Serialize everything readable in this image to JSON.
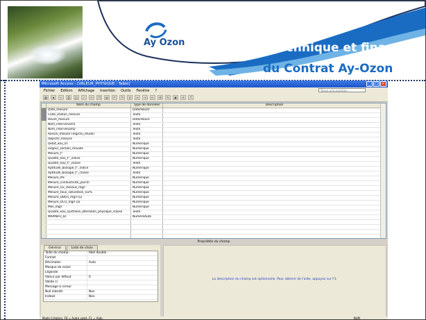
{
  "slide": {
    "logo_text": "Ay Ozon",
    "title_line1": "Suivi technique et financier",
    "title_line2": "du Contrat Ay-Ozon"
  },
  "window": {
    "title": "Microsoft Access - [VALEUR_PHYSIQUE : Table]",
    "menu": [
      "Fichier",
      "Edition",
      "Affichage",
      "Insertion",
      "Outils",
      "Fenêtre",
      "?"
    ],
    "help_placeholder": "Tapez une question"
  },
  "grid": {
    "headers": [
      "Nom du champ",
      "Type de données",
      "Description"
    ],
    "rows": [
      {
        "name": "Date_mesure",
        "type": "Date/Heure"
      },
      {
        "name": "Code_station_mesure",
        "type": "Texte"
      },
      {
        "name": "Heure_mesure",
        "type": "Date/Heure"
      },
      {
        "name": "Nom_intervenant1",
        "type": "Texte"
      },
      {
        "name": "Nom_intervenant2",
        "type": "Texte"
      },
      {
        "name": "Raison_mesure (reg/ctu_etude)",
        "type": "Texte"
      },
      {
        "name": "Objectif_mesure",
        "type": "Texte"
      },
      {
        "name": "Debit_eau_l/s",
        "type": "Numérique"
      },
      {
        "name": "largeur_section_mouille",
        "type": "Numérique"
      },
      {
        "name": "Mesure_t°",
        "type": "Numérique"
      },
      {
        "name": "Qualite_eau_t°_indice",
        "type": "Numérique"
      },
      {
        "name": "Qualite_eau_t°_classe",
        "type": "Texte"
      },
      {
        "name": "Aptitude_biologie_t°_indice",
        "type": "Numérique"
      },
      {
        "name": "Aptitude_biologie_t°_classe",
        "type": "Texte"
      },
      {
        "name": "Mesure_PH",
        "type": "Numérique"
      },
      {
        "name": "Mesure_conductivite_µS/cm",
        "type": "Numérique"
      },
      {
        "name": "Mesure_O2_dissous_mg/l",
        "type": "Numérique"
      },
      {
        "name": "Mesure_taux_saturation_O2%",
        "type": "Numérique"
      },
      {
        "name": "Mesure_DBO5_mg/l O2",
        "type": "Numérique"
      },
      {
        "name": "Mesure_DCO_mg/l O2",
        "type": "Numérique"
      },
      {
        "name": "Mes_mg/l",
        "type": "Numérique"
      },
      {
        "name": "Qualite_eau_synthese_alteration_physique_classe",
        "type": "Texte"
      },
      {
        "name": "MAPINFO_ID",
        "type": "NuméroAuto"
      }
    ]
  },
  "properties": {
    "title": "Propriétés du champ",
    "tabs": [
      "Général",
      "Liste de choix"
    ],
    "rows": [
      {
        "label": "Taille du champ",
        "value": "Réel double"
      },
      {
        "label": "Format",
        "value": ""
      },
      {
        "label": "Décimales",
        "value": "Auto"
      },
      {
        "label": "Masque de saisie",
        "value": ""
      },
      {
        "label": "Légende",
        "value": ""
      },
      {
        "label": "Valeur par défaut",
        "value": "0"
      },
      {
        "label": "Valide si",
        "value": ""
      },
      {
        "label": "Message si erreur",
        "value": ""
      },
      {
        "label": "Null interdit",
        "value": "Non"
      },
      {
        "label": "Indexé",
        "value": "Non"
      }
    ],
    "hint": "La description du champ est optionnelle. Pour obtenir de l'aide, appuyez sur F1."
  },
  "status": {
    "left": "Mode Création. F6 = Autre volet. F1 = Aide.",
    "right": "NUM"
  }
}
